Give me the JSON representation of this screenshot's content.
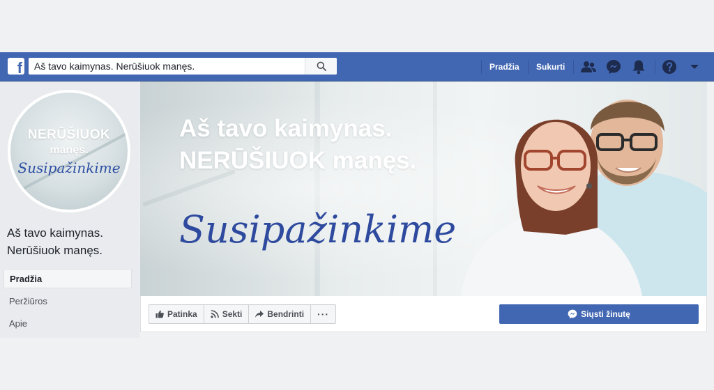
{
  "search": {
    "value": "Aš tavo kaimynas. Nerūšiuok manęs."
  },
  "topnav": {
    "home": "Pradžia",
    "create": "Sukurti"
  },
  "profile": {
    "line1": "NERŪŠIUOK",
    "line2": "manęs.",
    "script": "Susipažinkime"
  },
  "page": {
    "name": "Aš tavo kaimynas. Nerūšiuok manęs."
  },
  "sidebar": {
    "items": [
      {
        "label": "Pradžia"
      },
      {
        "label": "Peržiūros"
      },
      {
        "label": "Apie"
      }
    ]
  },
  "cover": {
    "headline1": "Aš tavo kaimynas.",
    "headline2": "NERŪŠIUOK manęs.",
    "script": "Susipažinkime"
  },
  "actions": {
    "like": "Patinka",
    "follow": "Sekti",
    "share": "Bendrinti",
    "more": "···",
    "message": "Siųsti žinutę"
  },
  "colors": {
    "brand": "#4267b2",
    "script": "#2e4a9e"
  }
}
